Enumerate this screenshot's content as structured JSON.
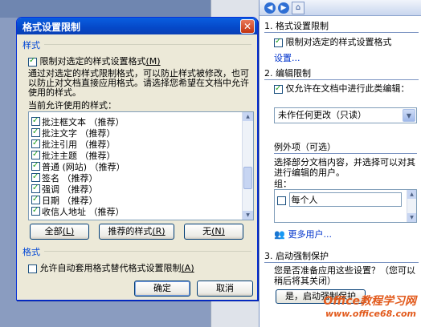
{
  "dialog": {
    "title": "格式设置限制",
    "close": "✕",
    "section_style": "样式",
    "limit_checkbox": {
      "label": "限制对选定的样式设置格式",
      "key": "(M)",
      "checked": true
    },
    "description": "通过对选定的样式限制格式，可以防止样式被修改，也可以防止对文档直接应用格式。请选择您希望在文档中允许使用的样式。",
    "allowed_label": "当前允许使用的样式：",
    "styles": [
      {
        "label": "批注框文本 （推荐）",
        "checked": true
      },
      {
        "label": "批注文字 （推荐）",
        "checked": true
      },
      {
        "label": "批注引用 （推荐）",
        "checked": true
      },
      {
        "label": "批注主题 （推荐）",
        "checked": true
      },
      {
        "label": "普通 (网站) （推荐）",
        "checked": true
      },
      {
        "label": "签名 （推荐）",
        "checked": true
      },
      {
        "label": "强调 （推荐）",
        "checked": true
      },
      {
        "label": "日期 （推荐）",
        "checked": true
      },
      {
        "label": "收信人地址 （推荐）",
        "checked": true
      }
    ],
    "btn_all": {
      "label": "全部",
      "key": "(L)"
    },
    "btn_recommended": {
      "label": "推荐的样式",
      "key": "(R)"
    },
    "btn_none": {
      "label": "无",
      "key": "(N)"
    },
    "section_format": "格式",
    "autoformat_checkbox": {
      "label": "允许自动套用格式替代格式设置限制",
      "key": "(A)",
      "checked": false
    },
    "ok": "确定",
    "cancel": "取消"
  },
  "pane": {
    "nav": {
      "back": "◀",
      "forward": "▶",
      "home": "⌂"
    },
    "s1": {
      "title": "1. 格式设置限制",
      "checkbox": "限制对选定的样式设置格式",
      "checked": true,
      "link": "设置..."
    },
    "s2": {
      "title": "2. 编辑限制",
      "checkbox": "仅允许在文档中进行此类编辑：",
      "checked": true,
      "select": "未作任何更改（只读）"
    },
    "exceptions": {
      "title": "例外项（可选）",
      "desc": "选择部分文档内容，并选择可以对其进行编辑的用户。",
      "group_label": "组：",
      "group_item": "每个人",
      "more_users": "更多用户..."
    },
    "s3": {
      "title": "3. 启动强制保护",
      "question": "您是否准备应用这些设置？（您可以稍后将其关闭）",
      "button": "是，启动强制保护"
    }
  },
  "watermark": {
    "line1": "Office教程学习网",
    "line2": "www.office68.com"
  },
  "colors": {
    "title_bar": "#0548c8",
    "dialog_bg": "#ece9d8",
    "pane_header": "#c9d6ee",
    "link": "#0033cc"
  }
}
